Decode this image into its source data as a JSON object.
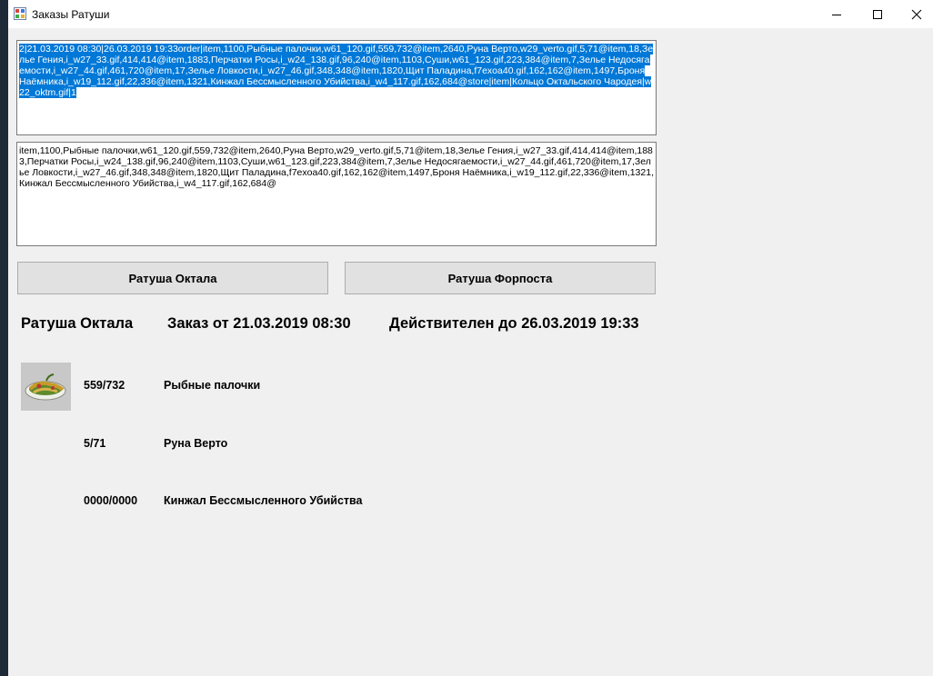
{
  "window": {
    "title": "Заказы Ратуши"
  },
  "raw_text": {
    "selected": "2|21.03.2019 08:30|26.03.2019 19:33order|item,1100,Рыбные палочки,w61_120.gif,559,732@item,2640,Руна Верто,w29_verto.gif,5,71@item,18,Зелье Гения,i_w27_33.gif,414,414@item,1883,Перчатки Росы,i_w24_138.gif,96,240@item,1103,Суши,w61_123.gif,223,384@item,7,Зелье Недосягаемости,i_w27_44.gif,461,720@item,17,Зелье Ловкости,i_w27_46.gif,348,348@item,1820,Щит Паладина,f7exoa40.gif,162,162@item,1497,Броня Наёмника,i_w19_112.gif,22,336@item,1321,Кинжал Бессмысленного Убийства,i_w4_117.gif,162,684@store|item|Кольцо Октальского Чародея|w22_oktm.gif|1"
  },
  "parsed_text": "item,1100,Рыбные палочки,w61_120.gif,559,732@item,2640,Руна Верто,w29_verto.gif,5,71@item,18,Зелье Гения,i_w27_33.gif,414,414@item,1883,Перчатки Росы,i_w24_138.gif,96,240@item,1103,Суши,w61_123.gif,223,384@item,7,Зелье Недосягаемости,i_w27_44.gif,461,720@item,17,Зелье Ловкости,i_w27_46.gif,348,348@item,1820,Щит Паладина,f7exoa40.gif,162,162@item,1497,Броня Наёмника,i_w19_112.gif,22,336@item,1321,Кинжал Бессмысленного Убийства,i_w4_117.gif,162,684@",
  "buttons": {
    "oktal": "Ратуша Октала",
    "forpost": "Ратуша Форпоста"
  },
  "header": {
    "town": "Ратуша Октала",
    "order": "Заказ от 21.03.2019 08:30",
    "valid": "Действителен до 26.03.2019 19:33"
  },
  "items": [
    {
      "qty": "559/732",
      "name": "Рыбные палочки",
      "icon": "fish-sticks-icon"
    },
    {
      "qty": "5/71",
      "name": "Руна Верто"
    },
    {
      "qty": "0000/0000",
      "name": "Кинжал Бессмысленного Убийства"
    }
  ],
  "colors": {
    "selection": "#0078d7",
    "background": "#f0f0f0"
  }
}
